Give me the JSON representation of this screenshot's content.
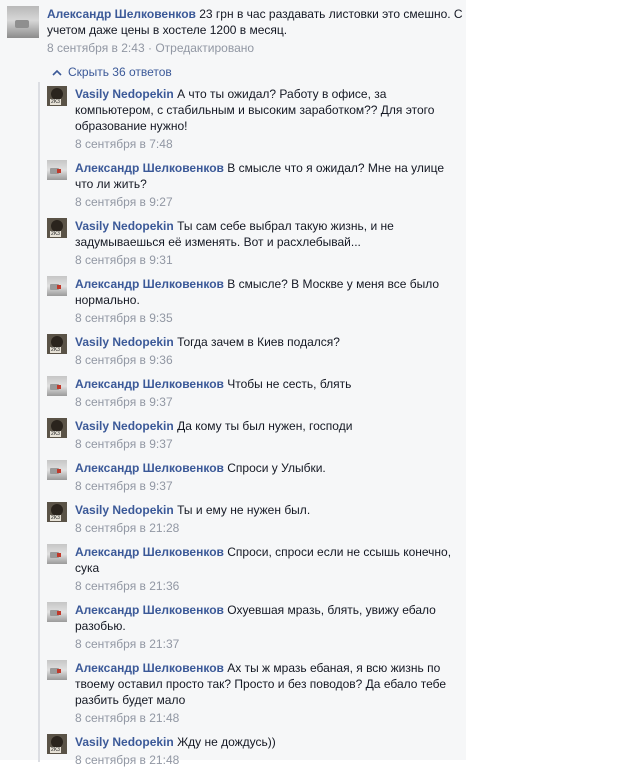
{
  "main_comment": {
    "author": "Александр Шелковенков",
    "text": "23 грн в час раздавать листовки это смешно. С учетом даже цены в хостеле 1200 в месяц.",
    "timestamp": "8 сентября в 2:43",
    "separator": "·",
    "edited": "Отредактировано"
  },
  "toggle": {
    "label": "Скрыть 36 ответов"
  },
  "replies": [
    {
      "author": "Vasily Nedopekin",
      "avatar": "vasily-avatar",
      "text": "А что ты ожидал? Работу в офисе, за компьютером, с стабильным и высоким заработком?? Для этого образование нужно!",
      "time": "8 сентября в 7:48"
    },
    {
      "author": "Александр Шелковенков",
      "avatar": "alex-avatar",
      "text": "В смысле что я ожидал? Мне на улице что ли жить?",
      "time": "8 сентября в 9:27"
    },
    {
      "author": "Vasily Nedopekin",
      "avatar": "vasily-avatar",
      "text": "Ты сам себе выбрал такую жизнь, и не задумываешься её изменять. Вот и расхлебывай...",
      "time": "8 сентября в 9:31"
    },
    {
      "author": "Александр Шелковенков",
      "avatar": "alex-avatar",
      "text": "В смысле? В Москве у меня все было нормально.",
      "time": "8 сентября в 9:35"
    },
    {
      "author": "Vasily Nedopekin",
      "avatar": "vasily-avatar",
      "text": "Тогда зачем в Киев подался?",
      "time": "8 сентября в 9:36"
    },
    {
      "author": "Александр Шелковенков",
      "avatar": "alex-avatar",
      "text": "Чтобы не сесть, блять",
      "time": "8 сентября в 9:37"
    },
    {
      "author": "Vasily Nedopekin",
      "avatar": "vasily-avatar",
      "text": "Да кому ты был нужен, господи",
      "time": "8 сентября в 9:37"
    },
    {
      "author": "Александр Шелковенков",
      "avatar": "alex-avatar",
      "text": "Спроси у Улыбки.",
      "time": "8 сентября в 9:37"
    },
    {
      "author": "Vasily Nedopekin",
      "avatar": "vasily-avatar",
      "text": "Ты и ему не нужен был.",
      "time": "8 сентября в 21:28"
    },
    {
      "author": "Александр Шелковенков",
      "avatar": "alex-avatar",
      "text": "Спроси, спроси если не ссышь конечно, сука",
      "time": "8 сентября в 21:36"
    },
    {
      "author": "Александр Шелковенков",
      "avatar": "alex-avatar",
      "text": "Охуевшая мразь, блять, увижу ебало разобью.",
      "time": "8 сентября в 21:37"
    },
    {
      "author": "Александр Шелковенков",
      "avatar": "alex-avatar",
      "text": "Ах ты ж мразь ебаная, я всю жизнь по твоему оставил просто так? Просто и без поводов? Да ебало тебе разбить будет мало",
      "time": "8 сентября в 21:48"
    },
    {
      "author": "Vasily Nedopekin",
      "avatar": "vasily-avatar",
      "text": "Жду не дождусь))",
      "time": "8 сентября в 21:48"
    }
  ]
}
